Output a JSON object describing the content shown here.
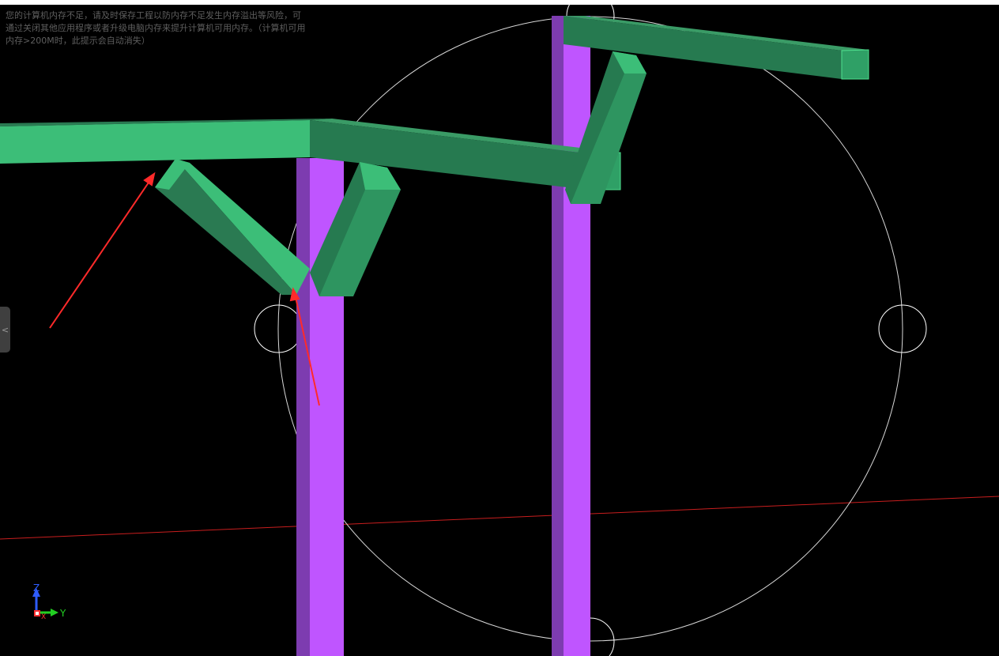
{
  "notice": {
    "text": "您的计算机内存不足，请及时保存工程以防内存不足发生内存溢出等风险，可通过关闭其他应用程序或者升级电脑内存来提升计算机可用内存。（计算机可用内存>200M时，此提示会自动消失）"
  },
  "side_panel": {
    "toggle_glyph": "<"
  },
  "axis_triad": {
    "z": "Z",
    "y": "Y",
    "x": "X"
  },
  "colors": {
    "background": "#000000",
    "column": "#bf55ff",
    "column_shade": "#7d3cb0",
    "beam": "#3cbe78",
    "beam_shade": "#2a7a52",
    "annotation_arrow": "#ff2a2a",
    "ground_axis_line": "#c81e1e",
    "view_cube_ring": "#d8d8d8"
  }
}
